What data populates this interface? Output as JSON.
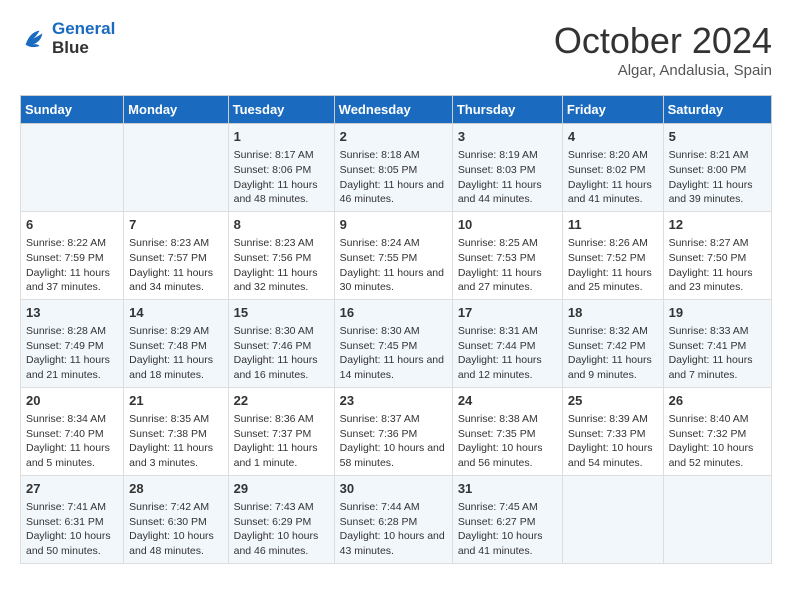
{
  "header": {
    "logo_line1": "General",
    "logo_line2": "Blue",
    "month": "October 2024",
    "location": "Algar, Andalusia, Spain"
  },
  "days_of_week": [
    "Sunday",
    "Monday",
    "Tuesday",
    "Wednesday",
    "Thursday",
    "Friday",
    "Saturday"
  ],
  "weeks": [
    [
      {
        "day": "",
        "content": ""
      },
      {
        "day": "",
        "content": ""
      },
      {
        "day": "1",
        "content": "Sunrise: 8:17 AM\nSunset: 8:06 PM\nDaylight: 11 hours and 48 minutes."
      },
      {
        "day": "2",
        "content": "Sunrise: 8:18 AM\nSunset: 8:05 PM\nDaylight: 11 hours and 46 minutes."
      },
      {
        "day": "3",
        "content": "Sunrise: 8:19 AM\nSunset: 8:03 PM\nDaylight: 11 hours and 44 minutes."
      },
      {
        "day": "4",
        "content": "Sunrise: 8:20 AM\nSunset: 8:02 PM\nDaylight: 11 hours and 41 minutes."
      },
      {
        "day": "5",
        "content": "Sunrise: 8:21 AM\nSunset: 8:00 PM\nDaylight: 11 hours and 39 minutes."
      }
    ],
    [
      {
        "day": "6",
        "content": "Sunrise: 8:22 AM\nSunset: 7:59 PM\nDaylight: 11 hours and 37 minutes."
      },
      {
        "day": "7",
        "content": "Sunrise: 8:23 AM\nSunset: 7:57 PM\nDaylight: 11 hours and 34 minutes."
      },
      {
        "day": "8",
        "content": "Sunrise: 8:23 AM\nSunset: 7:56 PM\nDaylight: 11 hours and 32 minutes."
      },
      {
        "day": "9",
        "content": "Sunrise: 8:24 AM\nSunset: 7:55 PM\nDaylight: 11 hours and 30 minutes."
      },
      {
        "day": "10",
        "content": "Sunrise: 8:25 AM\nSunset: 7:53 PM\nDaylight: 11 hours and 27 minutes."
      },
      {
        "day": "11",
        "content": "Sunrise: 8:26 AM\nSunset: 7:52 PM\nDaylight: 11 hours and 25 minutes."
      },
      {
        "day": "12",
        "content": "Sunrise: 8:27 AM\nSunset: 7:50 PM\nDaylight: 11 hours and 23 minutes."
      }
    ],
    [
      {
        "day": "13",
        "content": "Sunrise: 8:28 AM\nSunset: 7:49 PM\nDaylight: 11 hours and 21 minutes."
      },
      {
        "day": "14",
        "content": "Sunrise: 8:29 AM\nSunset: 7:48 PM\nDaylight: 11 hours and 18 minutes."
      },
      {
        "day": "15",
        "content": "Sunrise: 8:30 AM\nSunset: 7:46 PM\nDaylight: 11 hours and 16 minutes."
      },
      {
        "day": "16",
        "content": "Sunrise: 8:30 AM\nSunset: 7:45 PM\nDaylight: 11 hours and 14 minutes."
      },
      {
        "day": "17",
        "content": "Sunrise: 8:31 AM\nSunset: 7:44 PM\nDaylight: 11 hours and 12 minutes."
      },
      {
        "day": "18",
        "content": "Sunrise: 8:32 AM\nSunset: 7:42 PM\nDaylight: 11 hours and 9 minutes."
      },
      {
        "day": "19",
        "content": "Sunrise: 8:33 AM\nSunset: 7:41 PM\nDaylight: 11 hours and 7 minutes."
      }
    ],
    [
      {
        "day": "20",
        "content": "Sunrise: 8:34 AM\nSunset: 7:40 PM\nDaylight: 11 hours and 5 minutes."
      },
      {
        "day": "21",
        "content": "Sunrise: 8:35 AM\nSunset: 7:38 PM\nDaylight: 11 hours and 3 minutes."
      },
      {
        "day": "22",
        "content": "Sunrise: 8:36 AM\nSunset: 7:37 PM\nDaylight: 11 hours and 1 minute."
      },
      {
        "day": "23",
        "content": "Sunrise: 8:37 AM\nSunset: 7:36 PM\nDaylight: 10 hours and 58 minutes."
      },
      {
        "day": "24",
        "content": "Sunrise: 8:38 AM\nSunset: 7:35 PM\nDaylight: 10 hours and 56 minutes."
      },
      {
        "day": "25",
        "content": "Sunrise: 8:39 AM\nSunset: 7:33 PM\nDaylight: 10 hours and 54 minutes."
      },
      {
        "day": "26",
        "content": "Sunrise: 8:40 AM\nSunset: 7:32 PM\nDaylight: 10 hours and 52 minutes."
      }
    ],
    [
      {
        "day": "27",
        "content": "Sunrise: 7:41 AM\nSunset: 6:31 PM\nDaylight: 10 hours and 50 minutes."
      },
      {
        "day": "28",
        "content": "Sunrise: 7:42 AM\nSunset: 6:30 PM\nDaylight: 10 hours and 48 minutes."
      },
      {
        "day": "29",
        "content": "Sunrise: 7:43 AM\nSunset: 6:29 PM\nDaylight: 10 hours and 46 minutes."
      },
      {
        "day": "30",
        "content": "Sunrise: 7:44 AM\nSunset: 6:28 PM\nDaylight: 10 hours and 43 minutes."
      },
      {
        "day": "31",
        "content": "Sunrise: 7:45 AM\nSunset: 6:27 PM\nDaylight: 10 hours and 41 minutes."
      },
      {
        "day": "",
        "content": ""
      },
      {
        "day": "",
        "content": ""
      }
    ]
  ]
}
